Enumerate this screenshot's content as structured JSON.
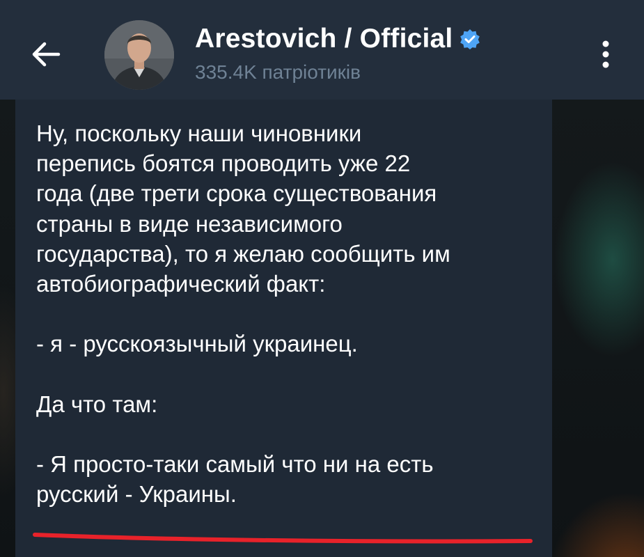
{
  "header": {
    "back_icon": "arrow-left-icon",
    "channel_name": "Arestovich / Official",
    "verified_icon": "verified-badge-icon",
    "subscribers": "335.4K патріотиків",
    "menu_icon": "more-vertical-icon"
  },
  "message": {
    "text": "Ну, поскольку наши чиновники\nперепись боятся проводить уже 22\nгода (две трети срока существования\nстраны в виде независимого\nгосударства), то я желаю сообщить им\nавтобиографический факт:\n\n- я - русскоязычный украинец.\n\nДа что там:\n\n- Я просто-таки самый что ни на есть\nрусский - Украины."
  },
  "colors": {
    "header_bg": "#232e3c",
    "bubble_bg": "#1f2936",
    "subtitle": "#6f8295",
    "verified": "#4ea4f5",
    "annotation_underline": "#e8222a"
  }
}
